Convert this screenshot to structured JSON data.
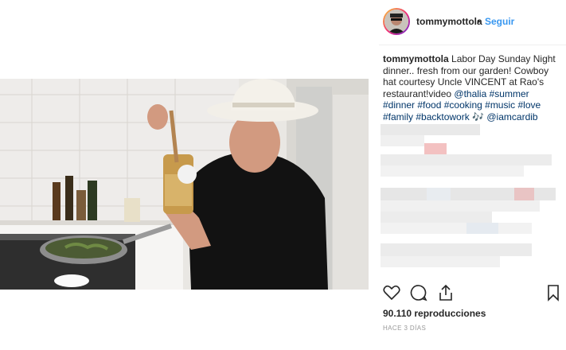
{
  "post": {
    "username": "tommymottola",
    "separator": "•",
    "follow_label": "Seguir",
    "caption": {
      "text_1": "Labor Day Sunday Night dinner.. fresh from our garden! Cowboy hat courtesy Uncle VINCENT at Rao's restaurant!video ",
      "tag_thalia": "@thalia",
      "tag_summer": "#summer",
      "tag_dinner": "#dinner",
      "tag_food": "#food",
      "tag_cooking": "#cooking",
      "tag_music": "#music",
      "tag_love": "#love",
      "tag_family": "#family",
      "tag_backtowork": "#backtowork",
      "note": "🎶",
      "tag_iamcardib": "@iamcardib"
    },
    "views": "90.110 reproducciones",
    "timestamp": "HACE 3 DÍAS"
  },
  "icons": {
    "like": "heart-icon",
    "comment": "comment-icon",
    "share": "share-icon",
    "save": "bookmark-icon"
  },
  "colors": {
    "link": "#003569",
    "follow": "#3897f0",
    "text": "#262626",
    "muted": "#999999"
  }
}
